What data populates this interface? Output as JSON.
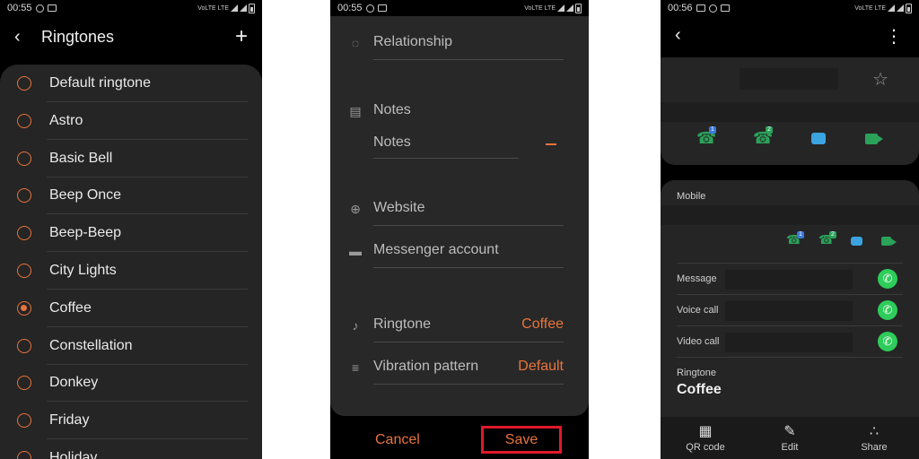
{
  "screen1": {
    "status": {
      "time": "00:55",
      "net": "VoLTE LTE"
    },
    "header": {
      "title": "Ringtones",
      "back_icon": "back-arrow-icon",
      "add_icon": "plus-icon"
    },
    "ringtones": [
      {
        "label": "Default ringtone",
        "selected": false
      },
      {
        "label": "Astro",
        "selected": false
      },
      {
        "label": "Basic Bell",
        "selected": false
      },
      {
        "label": "Beep Once",
        "selected": false
      },
      {
        "label": "Beep-Beep",
        "selected": false
      },
      {
        "label": "City Lights",
        "selected": false
      },
      {
        "label": "Coffee",
        "selected": true
      },
      {
        "label": "Constellation",
        "selected": false
      },
      {
        "label": "Donkey",
        "selected": false
      },
      {
        "label": "Friday",
        "selected": false
      },
      {
        "label": "Holiday",
        "selected": false
      }
    ],
    "accent": "#e8743c"
  },
  "screen2": {
    "status": {
      "time": "00:55",
      "net": "VoLTE LTE"
    },
    "fields": {
      "relationship": "Relationship",
      "notes_section": "Notes",
      "notes_placeholder": "Notes",
      "website": "Website",
      "messenger": "Messenger account",
      "ringtone_label": "Ringtone",
      "ringtone_value": "Coffee",
      "vibration_label": "Vibration pattern",
      "vibration_value": "Default"
    },
    "buttons": {
      "cancel": "Cancel",
      "save": "Save"
    },
    "highlight_color": "#e0192a"
  },
  "screen3": {
    "status": {
      "time": "00:56",
      "net": "VoLTE LTE"
    },
    "mobile_label": "Mobile",
    "actions": [
      {
        "label": "Message"
      },
      {
        "label": "Voice call"
      },
      {
        "label": "Video call"
      }
    ],
    "ringtone_label": "Ringtone",
    "ringtone_value": "Coffee",
    "sim1": "1",
    "sim2": "2",
    "bottom": {
      "qr": "QR code",
      "edit": "Edit",
      "share": "Share"
    }
  }
}
